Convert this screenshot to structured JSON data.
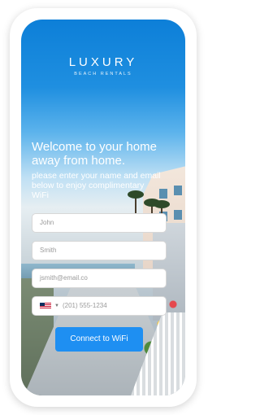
{
  "brand": {
    "name": "LUXURY",
    "tagline": "BEACH RENTALS"
  },
  "welcome": {
    "title": "Welcome to your home away from home.",
    "intro": "please enter your name and email below to enjoy complimentary WiFi"
  },
  "form": {
    "first_name": "John",
    "last_name": "Smith",
    "email": "jsmith@email.co",
    "phone": "(201) 555-1234",
    "country_caret": "▼",
    "submit_label": "Connect to WiFi"
  },
  "colors": {
    "accent": "#1e8ff2",
    "sky": "#0d7fd8"
  }
}
